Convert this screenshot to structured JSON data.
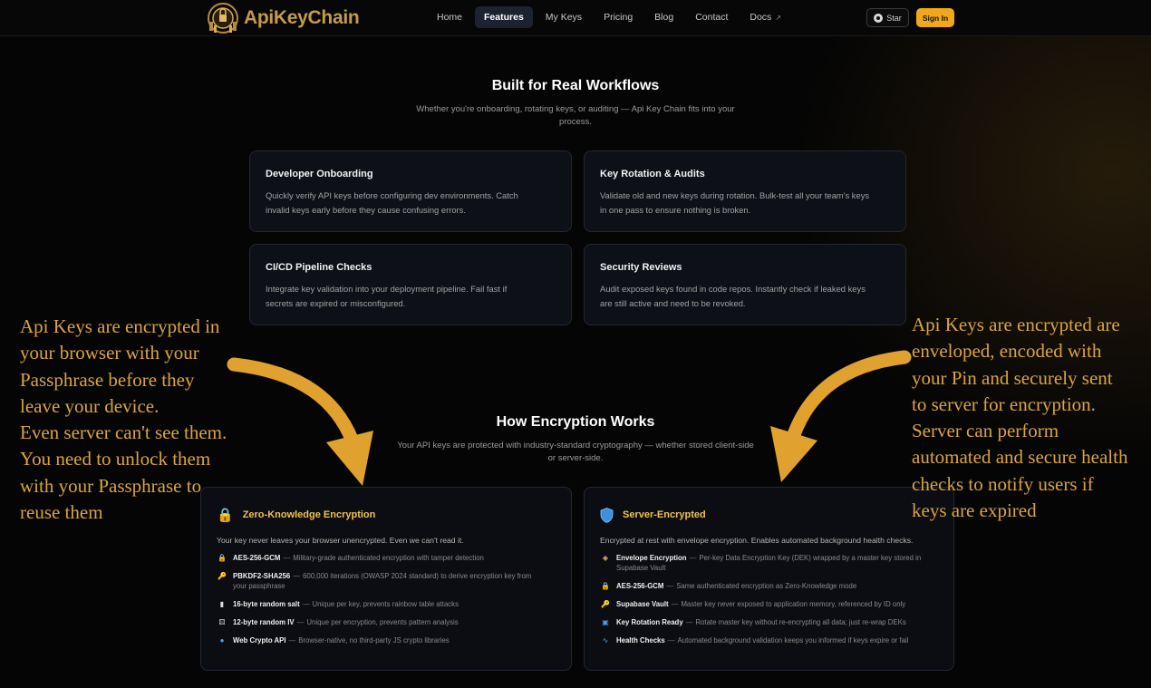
{
  "nav": {
    "brand": "ApiKeyChain",
    "links": [
      {
        "label": "Home"
      },
      {
        "label": "Features"
      },
      {
        "label": "My Keys"
      },
      {
        "label": "Pricing"
      },
      {
        "label": "Blog"
      },
      {
        "label": "Contact"
      },
      {
        "label": "Docs"
      }
    ],
    "star_label": "Star",
    "signin_label": "Sign In"
  },
  "workflows": {
    "title": "Built for Real Workflows",
    "subtitle_1": "Whether you're onboarding, rotating keys, or auditing — Api Key Chain fits into your",
    "subtitle_2": "process.",
    "cards": [
      {
        "title": "Developer Onboarding",
        "desc_1": "Quickly verify API keys before configuring dev environments. Catch",
        "desc_2": "invalid keys early before they cause confusing errors."
      },
      {
        "title": "Key Rotation & Audits",
        "desc_1": "Validate old and new keys during rotation. Bulk-test all your team's keys",
        "desc_2": "in one pass to ensure nothing is broken."
      },
      {
        "title": "CI/CD Pipeline Checks",
        "desc_1": "Integrate key validation into your deployment pipeline. Fail fast if",
        "desc_2": "secrets are expired or misconfigured."
      },
      {
        "title": "Security Reviews",
        "desc_1": "Audit exposed keys found in code repos. Instantly check if leaked keys",
        "desc_2": "are still active and need to be revoked."
      }
    ]
  },
  "encryption": {
    "title": "How Encryption Works",
    "subtitle_1": "Your API keys are protected with industry-standard cryptography — whether stored client-side",
    "subtitle_2": "or server-side.",
    "separator": "—",
    "zero_knowledge": {
      "title": "Zero-Knowledge Encryption",
      "title_color": "#f2c14e",
      "icon": "lock-icon",
      "desc": "Your key never leaves your browser unencrypted. Even we can't read it.",
      "features": [
        {
          "icon": "lock-icon",
          "label": "AES-256-GCM",
          "text": "Military-grade authenticated encryption with tamper detection"
        },
        {
          "icon": "key-icon",
          "label": "PBKDF2-SHA256",
          "text": "600,000 iterations (OWASP 2024 standard) to derive encryption key from",
          "text_2": "your passphrase"
        },
        {
          "icon": "salt-icon",
          "label": "16-byte random salt",
          "text": "Unique per key, prevents rainbow table attacks"
        },
        {
          "icon": "dice-icon",
          "label": "12-byte random IV",
          "text": "Unique per encryption, prevents pattern analysis"
        },
        {
          "icon": "globe-icon",
          "label": "Web Crypto API",
          "text": "Browser-native, no third-party JS crypto libraries"
        }
      ]
    },
    "server": {
      "title": "Server-Encrypted",
      "title_color": "#f2c14e",
      "icon": "shield-icon",
      "desc": "Encrypted at rest with envelope encryption. Enables automated background health checks.",
      "features": [
        {
          "icon": "package-icon",
          "label": "Envelope Encryption",
          "text": "Per-key Data Encryption Key (DEK) wrapped by a master key stored in",
          "text_2": "Supabase Vault"
        },
        {
          "icon": "lock-icon",
          "label": "AES-256-GCM",
          "text": "Same authenticated encryption as Zero-Knowledge mode"
        },
        {
          "icon": "key-icon",
          "label": "Supabase Vault",
          "text": "Master key never exposed to application memory, referenced by ID only"
        },
        {
          "icon": "rotate-icon",
          "label": "Key Rotation Ready",
          "text": "Rotate master key without re-encrypting all data; just re-wrap DEKs"
        },
        {
          "icon": "pulse-icon",
          "label": "Health Checks",
          "text": "Automated background validation keeps you informed if keys expire or fail"
        }
      ]
    }
  },
  "annotations": {
    "left": [
      "Api Keys are encrypted in",
      "your browser with your",
      "Passphrase before they",
      "leave your device.",
      "Even server can't see them.",
      "You need to unlock them",
      "with your Passphrase to",
      "reuse them"
    ],
    "right": [
      "Api Keys are encrypted are",
      "enveloped, encoded with",
      "your Pin and securely sent",
      "to server for encryption.",
      "Server can perform",
      "automated and secure health",
      "checks to notify users if",
      "keys are expired"
    ],
    "color": "#dba43a"
  }
}
